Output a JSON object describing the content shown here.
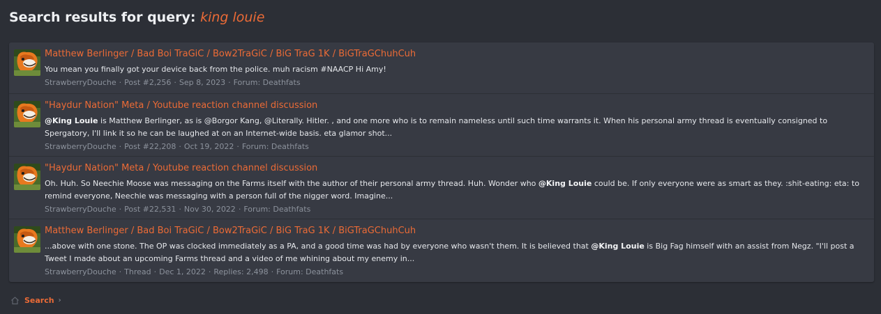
{
  "header": {
    "label": "Search results for query: ",
    "query": "king louie"
  },
  "results": [
    {
      "title": "Matthew Berlinger / Bad Boi TraGiC / Bow2TraGiC / BiG TraG 1K / BiGTraGChuhCuh",
      "snippet_parts": [
        {
          "t": "You mean you finally got your device back from the police. muh racism #NAACP Hi Amy!",
          "bold": false
        }
      ],
      "meta": {
        "author": "StrawberryDouche",
        "type": "Post #2,256",
        "date": "Sep 8, 2023",
        "replies": "",
        "forum": "Forum: Deathfats"
      }
    },
    {
      "title": "\"Haydur Nation\" Meta / Youtube reaction channel discussion",
      "snippet_parts": [
        {
          "t": "@King Louie",
          "bold": true
        },
        {
          "t": " is Matthew Berlinger, as is @Borgor Kang, @Literally. Hitler. , and one more who is to remain nameless until such time warrants it. When his personal army thread is eventually consigned to Spergatory, I'll link it so he can be laughed at on an Internet-wide basis. eta glamor shot...",
          "bold": false
        }
      ],
      "meta": {
        "author": "StrawberryDouche",
        "type": "Post #22,208",
        "date": "Oct 19, 2022",
        "replies": "",
        "forum": "Forum: Deathfats"
      }
    },
    {
      "title": "\"Haydur Nation\" Meta / Youtube reaction channel discussion",
      "snippet_parts": [
        {
          "t": "Oh. Huh. So Neechie Moose was messaging on the Farms itself with the author of their personal army thread. Huh. Wonder who ",
          "bold": false
        },
        {
          "t": "@King Louie",
          "bold": true
        },
        {
          "t": " could be. If only everyone were as smart as they. :shit-eating: eta: to remind everyone, Neechie was messaging with a person full of the nigger word. Imagine...",
          "bold": false
        }
      ],
      "meta": {
        "author": "StrawberryDouche",
        "type": "Post #22,531",
        "date": "Nov 30, 2022",
        "replies": "",
        "forum": "Forum: Deathfats"
      }
    },
    {
      "title": "Matthew Berlinger / Bad Boi TraGiC / Bow2TraGiC / BiG TraG 1K / BiGTraGChuhCuh",
      "snippet_parts": [
        {
          "t": "...above with one stone. The OP was clocked immediately as a PA, and a good time was had by everyone who wasn't them. It is believed that ",
          "bold": false
        },
        {
          "t": "@King Louie",
          "bold": true
        },
        {
          "t": " is Big Fag himself with an assist from Negz. \"I'll post a Tweet I made about an upcoming Farms thread and a video of me whining about my enemy in...",
          "bold": false
        }
      ],
      "meta": {
        "author": "StrawberryDouche",
        "type": "Thread",
        "date": "Dec 1, 2022",
        "replies": "Replies: 2,498",
        "forum": "Forum: Deathfats"
      }
    }
  ],
  "breadcrumb": {
    "home_icon": "home-icon",
    "label": "Search"
  },
  "colors": {
    "background": "#2c2f36",
    "panel": "#373a43",
    "accent": "#ec6b36",
    "muted": "#8c929c"
  }
}
